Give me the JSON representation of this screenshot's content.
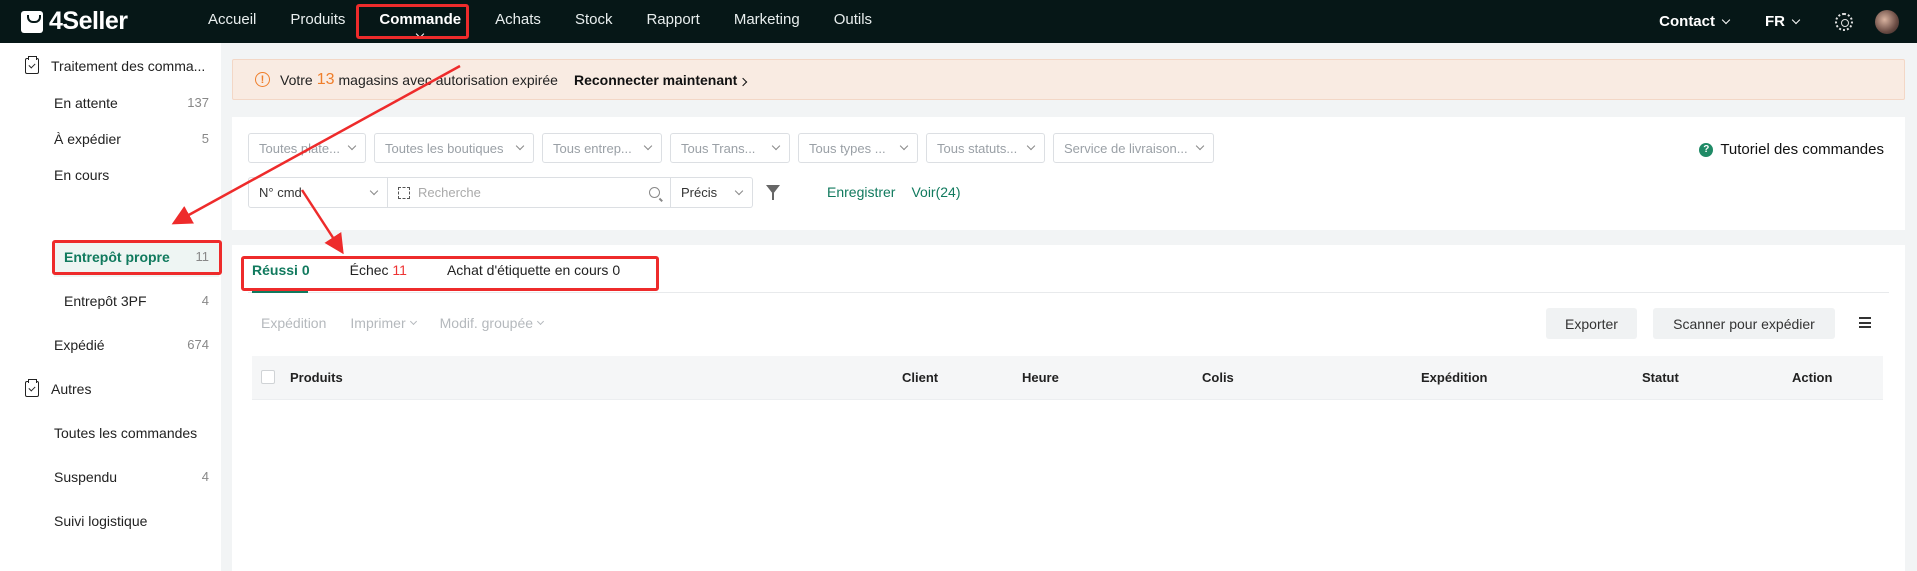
{
  "brand": {
    "name": "4Seller"
  },
  "nav": {
    "items": [
      "Accueil",
      "Produits",
      "Commande",
      "Achats",
      "Stock",
      "Rapport",
      "Marketing",
      "Outils"
    ],
    "active": "Commande",
    "contact": "Contact",
    "lang": "FR"
  },
  "sidebar": {
    "group1": "Traitement des comma...",
    "items": [
      {
        "label": "En attente",
        "count": "137"
      },
      {
        "label": "À expédier",
        "count": "5"
      },
      {
        "label": "En cours",
        "count": ""
      },
      {
        "label": "Entrepôt propre",
        "count": "11"
      },
      {
        "label": "Entrepôt 3PF",
        "count": "4"
      },
      {
        "label": "Expédié",
        "count": "674"
      }
    ],
    "group2": "Autres",
    "items2": [
      {
        "label": "Toutes les commandes",
        "count": ""
      },
      {
        "label": "Suspendu",
        "count": "4"
      },
      {
        "label": "Suivi logistique",
        "count": ""
      }
    ]
  },
  "banner": {
    "prefix": "Votre",
    "count": "13",
    "suffix": "magasins avec autorisation expirée",
    "action": "Reconnecter maintenant"
  },
  "filters": {
    "selects": [
      "Toutes plate...",
      "Toutes les boutiques",
      "Tous entrep...",
      "Tous Trans...",
      "Tous types ...",
      "Tous statuts...",
      "Service de livraison..."
    ],
    "tutorial": "Tutoriel des commandes",
    "search_field": "N° cmd",
    "search_placeholder": "Recherche",
    "match_mode": "Précis",
    "save_label": "Enregistrer",
    "view_label": "Voir(24)"
  },
  "tabs": {
    "success": {
      "label": "Réussi",
      "count": "0"
    },
    "failure": {
      "label": "Échec",
      "count": "11"
    },
    "label_purchase": {
      "label": "Achat d'étiquette en cours",
      "count": "0"
    }
  },
  "toolbar": {
    "shipping": "Expédition",
    "print": "Imprimer",
    "bulk_edit": "Modif. groupée",
    "export": "Exporter",
    "scan_ship": "Scanner pour expédier"
  },
  "table": {
    "columns": [
      "Produits",
      "Client",
      "Heure",
      "Colis",
      "Expédition",
      "Statut",
      "Action"
    ]
  },
  "colors": {
    "accent": "#117a5e",
    "topbar": "#061717",
    "warning": "#ef7e2b",
    "annotation": "#ee2b2b"
  }
}
